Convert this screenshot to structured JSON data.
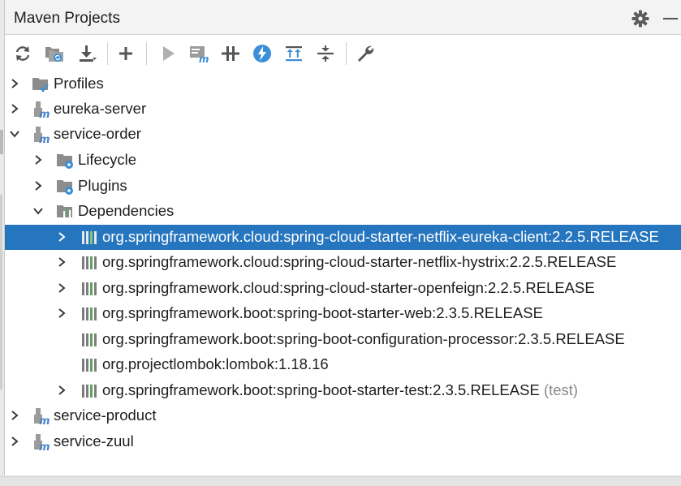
{
  "window": {
    "title": "Maven Projects"
  },
  "icons": {
    "settings": "gear-icon",
    "minimize": "minimize-icon",
    "project_folder": "maven-folder-icon",
    "dependency": "library-icon"
  },
  "colors": {
    "selection": "#2675bf",
    "run_disabled": "#b0b0b0",
    "lightning": "#3b8fd6",
    "maven_blue": "#4b84c9",
    "folder_grey": "#8c8c8c"
  },
  "toolbar": {
    "buttons": [
      {
        "name": "reimport-button",
        "icon": "refresh-icon"
      },
      {
        "name": "generate-sources-button",
        "icon": "folders-refresh-icon"
      },
      {
        "name": "download-button",
        "icon": "download-icon"
      },
      {
        "name": "add-project-button",
        "icon": "plus-icon"
      },
      {
        "name": "run-button",
        "icon": "play-icon"
      },
      {
        "name": "execute-goal-button",
        "icon": "maven-goal-icon"
      },
      {
        "name": "toggle-offline-button",
        "icon": "offline-icon"
      },
      {
        "name": "skip-tests-button",
        "icon": "lightning-icon"
      },
      {
        "name": "show-dependencies-button",
        "icon": "expand-all-icon"
      },
      {
        "name": "collapse-all-button",
        "icon": "collapse-all-icon"
      },
      {
        "name": "settings-button",
        "icon": "wrench-icon"
      }
    ]
  },
  "tree": {
    "profiles": "Profiles",
    "eureka_server": "eureka-server",
    "service_order": "service-order",
    "lifecycle": "Lifecycle",
    "plugins": "Plugins",
    "dependencies": "Dependencies",
    "deps": [
      "org.springframework.cloud:spring-cloud-starter-netflix-eureka-client:2.2.5.RELEASE",
      "org.springframework.cloud:spring-cloud-starter-netflix-hystrix:2.2.5.RELEASE",
      "org.springframework.cloud:spring-cloud-starter-openfeign:2.2.5.RELEASE",
      "org.springframework.boot:spring-boot-starter-web:2.3.5.RELEASE",
      "org.springframework.boot:spring-boot-configuration-processor:2.3.5.RELEASE",
      "org.projectlombok:lombok:1.18.16",
      "org.springframework.boot:spring-boot-starter-test:2.3.5.RELEASE"
    ],
    "test_scope": "(test)",
    "service_product": "service-product",
    "service_zuul": "service-zuul"
  }
}
